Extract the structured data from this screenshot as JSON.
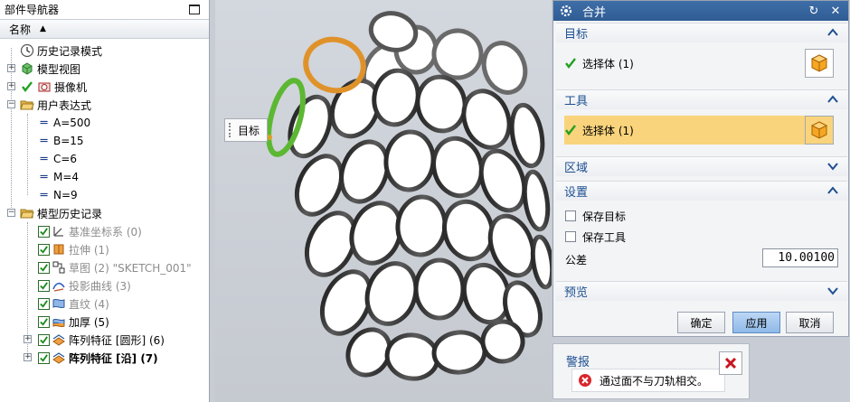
{
  "navigator": {
    "title": "部件导航器",
    "column_name": "名称",
    "items": [
      {
        "label": "历史记录模式",
        "icon": "clock-icon"
      },
      {
        "label": "模型视图",
        "icon": "model-views-icon"
      },
      {
        "label": "摄像机",
        "icon": "camera-icon"
      },
      {
        "label": "用户表达式",
        "icon": "folder-open-icon"
      },
      {
        "label": "A=500",
        "icon": "expression-icon"
      },
      {
        "label": "B=15",
        "icon": "expression-icon"
      },
      {
        "label": "C=6",
        "icon": "expression-icon"
      },
      {
        "label": "M=4",
        "icon": "expression-icon"
      },
      {
        "label": "N=9",
        "icon": "expression-icon"
      },
      {
        "label": "模型历史记录",
        "icon": "folder-open-icon"
      },
      {
        "label": "基准坐标系 (0)",
        "icon": "datum-csys-icon"
      },
      {
        "label": "拉伸 (1)",
        "icon": "extrude-icon"
      },
      {
        "label": "草图 (2) \"SKETCH_001\"",
        "icon": "sketch-icon"
      },
      {
        "label": "投影曲线 (3)",
        "icon": "projected-curve-icon"
      },
      {
        "label": "直纹 (4)",
        "icon": "ruled-surface-icon"
      },
      {
        "label": "加厚 (5)",
        "icon": "thicken-icon"
      },
      {
        "label": "阵列特征 [圆形] (6)",
        "icon": "pattern-feature-icon"
      },
      {
        "label": "阵列特征 [沿] (7)",
        "icon": "pattern-feature-icon"
      }
    ]
  },
  "viewport": {
    "tooltip_label": "目标"
  },
  "dialog": {
    "title": "合并",
    "target": {
      "heading": "目标",
      "selection": "选择体 (1)"
    },
    "tool": {
      "heading": "工具",
      "selection": "选择体 (1)"
    },
    "region": {
      "heading": "区域"
    },
    "settings": {
      "heading": "设置",
      "keep_target": "保存目标",
      "keep_tool": "保存工具",
      "tolerance_label": "公差",
      "tolerance_value": "10.00100"
    },
    "preview": {
      "heading": "预览"
    },
    "buttons": {
      "ok": "确定",
      "apply": "应用",
      "cancel": "取消"
    }
  },
  "alert": {
    "title": "警报",
    "message": "通过面不与刀轨相交。"
  },
  "colors": {
    "accent": "#1d4f91",
    "title_bar": "#3a6aa4",
    "highlight": "#f9d47c",
    "target_body": "#e0922a",
    "tool_body": "#5cb832",
    "mesh": "#3a3a3a"
  }
}
